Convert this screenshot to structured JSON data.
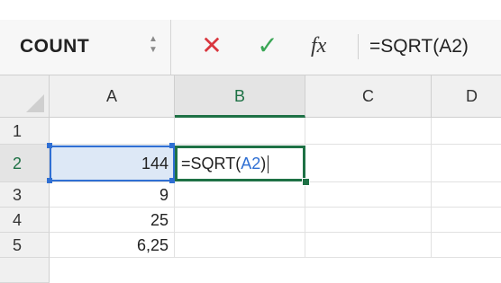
{
  "formula_bar": {
    "name_box": "COUNT",
    "cancel_icon": "✕",
    "enter_icon": "✓",
    "fx_label": "fx",
    "formula": "=SQRT(A2)"
  },
  "columns": [
    "A",
    "B",
    "C",
    "D"
  ],
  "rows": [
    "1",
    "2",
    "3",
    "4",
    "5"
  ],
  "cells": {
    "A2": "144",
    "A3": "9",
    "A4": "25",
    "A5": "6,25"
  },
  "editing_cell": {
    "address": "B2",
    "prefix": "=SQRT(",
    "reference": "A2",
    "suffix": ")"
  },
  "colors": {
    "accent_green": "#1e7145",
    "reference_blue": "#2f6fd3",
    "cancel_red": "#d9363e",
    "enter_green": "#3aa655"
  }
}
